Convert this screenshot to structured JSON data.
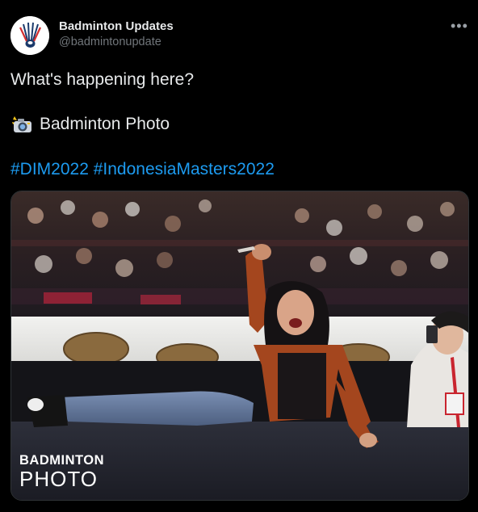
{
  "account": {
    "display_name": "Badminton Updates",
    "handle": "@badmintonupdate"
  },
  "menu_icon": "more-horizontal-icon",
  "tweet": {
    "line1": "What's happening here?",
    "line2_icon": "camera-flash-emoji",
    "line2_text": "Badminton Photo",
    "hashtags": [
      "#DIM2022",
      "#IndonesiaMasters2022"
    ]
  },
  "media": {
    "description_icon": "photo",
    "watermark_line1": "BADMINTON",
    "watermark_line2": "PHOTO"
  },
  "colors": {
    "background": "#000000",
    "text": "#e7e9ea",
    "secondary": "#71767b",
    "link": "#1d9bf0"
  }
}
